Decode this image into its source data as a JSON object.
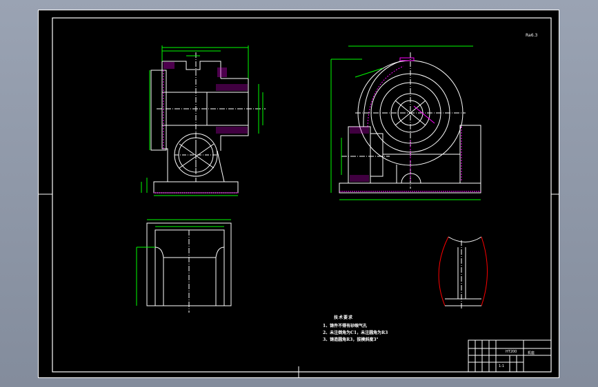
{
  "sheet": {
    "colors": {
      "background": "#000000",
      "frame": "#ffffff",
      "outline": "#ffffff",
      "dimension": "#00ff00",
      "centerline": "#ffffff",
      "hatch": "#ff00ff",
      "break_line": "#ff0000",
      "viewport_bg": "#8f97a6"
    },
    "corner_note": "Ra6.3",
    "technical_notes": {
      "heading": "技术要求",
      "items": [
        "1、铸件不得有砂眼气孔",
        "2、未注倒角为C1，未注圆角为R3",
        "3、铸造圆角R3，拔模斜度3°"
      ]
    },
    "title_block": {
      "part_name": "机座",
      "material": "HT200",
      "scale": "1:1"
    }
  }
}
